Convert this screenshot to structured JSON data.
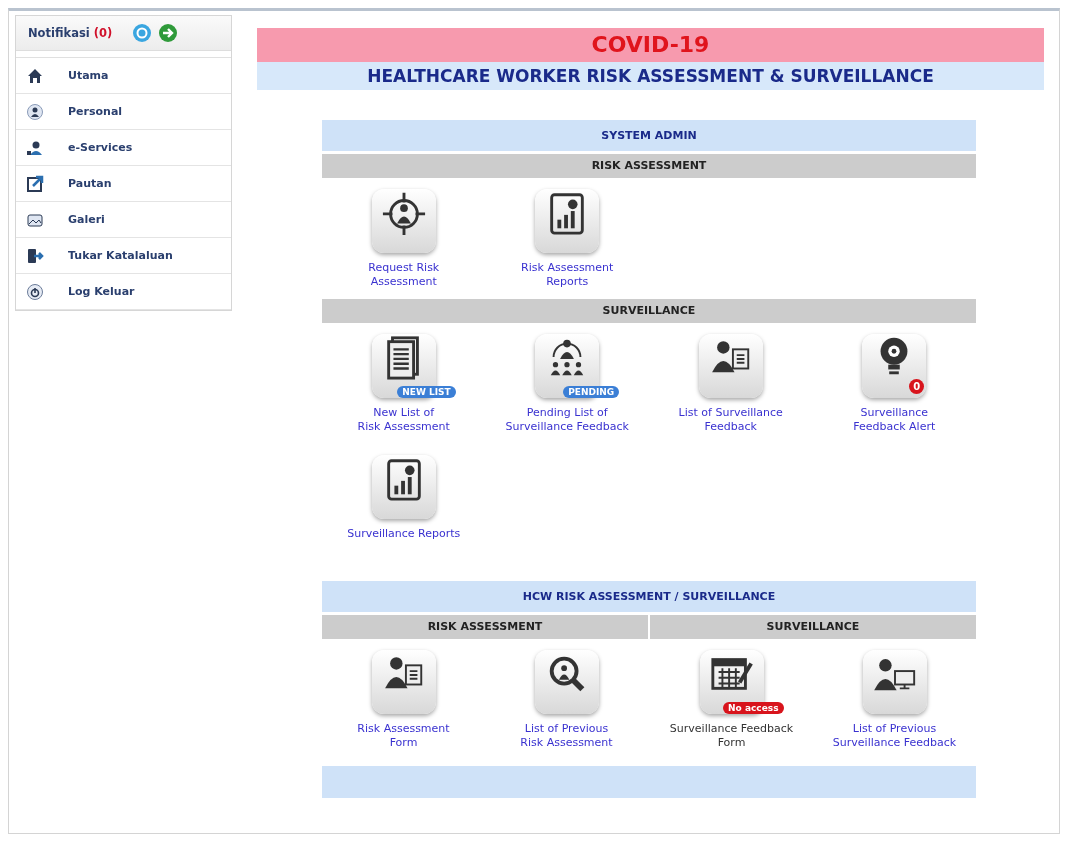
{
  "sidebar": {
    "header": {
      "title": "Notifikasi",
      "count": "(0)"
    },
    "items": [
      {
        "label": "Utama"
      },
      {
        "label": "Personal"
      },
      {
        "label": "e-Services"
      },
      {
        "label": "Pautan"
      },
      {
        "label": "Galeri"
      },
      {
        "label": "Tukar Katalaluan"
      },
      {
        "label": "Log Keluar"
      }
    ]
  },
  "banner": {
    "title": "COVID-19",
    "subtitle": "HEALTHCARE WORKER RISK ASSESSMENT & SURVEILLANCE"
  },
  "panels": [
    {
      "kind": "stacked",
      "title": "SYSTEM ADMIN",
      "groups": [
        {
          "heading": "RISK ASSESSMENT",
          "tiles": [
            {
              "label": "Request Risk\nAssessment",
              "disabled": false
            },
            {
              "label": "Risk Assessment\nReports",
              "disabled": false
            }
          ]
        },
        {
          "heading": "SURVEILLANCE",
          "tiles": [
            {
              "label": "New List of\nRisk Assessment",
              "disabled": false,
              "badge": {
                "kind": "pill",
                "text": "NEW LIST",
                "color": "#3b7fd6"
              }
            },
            {
              "label": "Pending List of\nSurveillance Feedback",
              "disabled": false,
              "badge": {
                "kind": "pill",
                "text": "PENDING",
                "color": "#3b7fd6"
              }
            },
            {
              "label": "List of Surveillance\nFeedback",
              "disabled": false
            },
            {
              "label": "Surveillance\nFeedback Alert",
              "disabled": false,
              "badge": {
                "kind": "count",
                "text": "0",
                "color": "#d8141c"
              }
            },
            {
              "label": "Surveillance Reports",
              "disabled": false
            }
          ]
        }
      ]
    },
    {
      "kind": "split",
      "title": "HCW RISK ASSESSMENT / SURVEILLANCE",
      "groups": [
        {
          "heading": "RISK ASSESSMENT",
          "tiles": [
            {
              "label": "Risk Assessment\nForm",
              "disabled": false
            },
            {
              "label": "List of Previous\nRisk Assessment",
              "disabled": false
            }
          ]
        },
        {
          "heading": "SURVEILLANCE",
          "tiles": [
            {
              "label": "Surveillance Feedback\nForm",
              "disabled": true,
              "badge": {
                "kind": "pill",
                "text": "No access",
                "color": "#d8141c"
              }
            },
            {
              "label": "List of Previous\nSurveillance Feedback",
              "disabled": false
            }
          ]
        }
      ]
    }
  ]
}
